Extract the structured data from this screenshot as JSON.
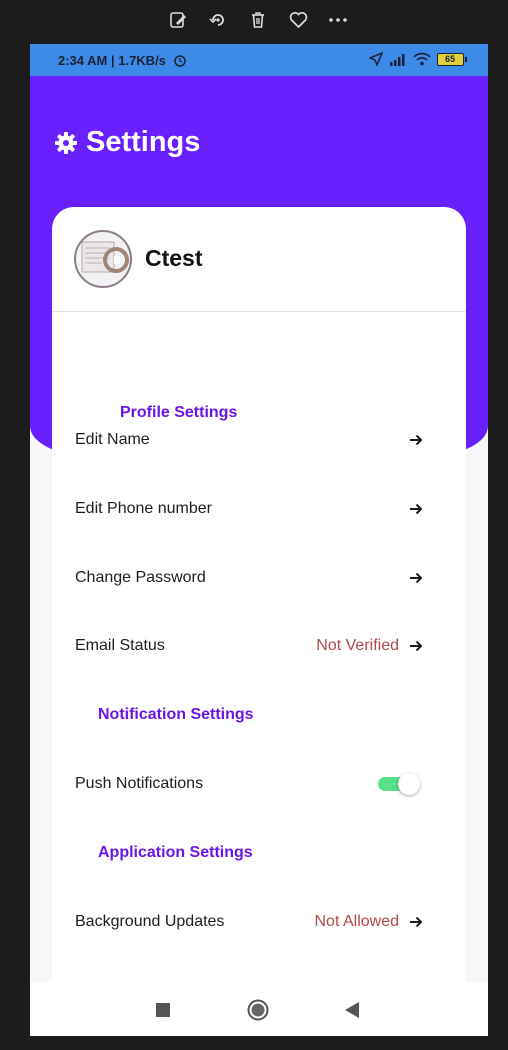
{
  "viewer_toolbar": {
    "icons": [
      "edit-image-icon",
      "rotate-icon",
      "trash-icon",
      "heart-icon",
      "more-icon"
    ]
  },
  "status_bar": {
    "time_and_speed": "2:34 AM | 1.7KB/s",
    "battery": "65"
  },
  "header": {
    "title": "Settings",
    "icon": "gear-icon"
  },
  "profile": {
    "username": "Ctest"
  },
  "sections": {
    "profile_title": "Profile Settings",
    "notification_title": "Notification Settings",
    "application_title": "Application Settings"
  },
  "rows": {
    "edit_name": "Edit Name",
    "edit_phone": "Edit Phone number",
    "change_password": "Change Password",
    "email_status": "Email Status",
    "email_status_value": "Not Verified",
    "push_notifications": "Push Notifications",
    "push_notifications_enabled": true,
    "background_updates": "Background Updates",
    "background_updates_value": "Not Allowed"
  },
  "colors": {
    "header_purple": "#6a1fff",
    "section_title": "#6a16e6",
    "status_value_red": "#b0484e",
    "toggle_green": "#58e08c",
    "status_bar_blue": "#3d8ae8"
  }
}
